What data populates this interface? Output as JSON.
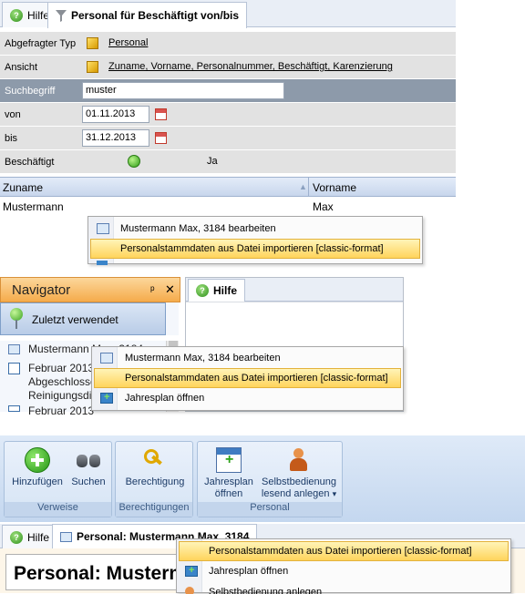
{
  "panel1": {
    "tabs": [
      {
        "label": "Hilfe",
        "icon": "help-icon"
      },
      {
        "label": "Personal für Beschäftigt von/bis",
        "icon": "filter-icon"
      }
    ],
    "filters": {
      "type_label": "Abgefragter Typ",
      "type_value": "Personal",
      "view_label": "Ansicht",
      "view_value": "Zuname, Vorname, Personalnummer, Beschäftigt, Karenzierung",
      "search_label": "Suchbegriff",
      "search_value": "muster",
      "from_label": "von",
      "from_value": "01.11.2013",
      "to_label": "bis",
      "to_value": "31.12.2013",
      "employed_label": "Beschäftigt",
      "employed_value": "Ja"
    },
    "grid": {
      "columns": [
        "Zuname",
        "Vorname"
      ],
      "rows": [
        [
          "Mustermann",
          "Max"
        ]
      ]
    },
    "context_menu": [
      "Mustermann Max, 3184 bearbeiten",
      "Personalstammdaten aus Datei importieren [classic-format]"
    ]
  },
  "panel2": {
    "navigator_title": "Navigator",
    "pin_glyph": "ᵖ",
    "close_glyph": "✕",
    "recent_label": "Zuletzt verwendet",
    "nav_items": [
      "Mustermann Max, 3184",
      "Februar 2013",
      "Abgeschlossen",
      "Reinigungsdienst",
      "Februar 2013"
    ],
    "hilfe_tab": "Hilfe",
    "context_menu": [
      "Mustermann Max, 3184 bearbeiten",
      "Personalstammdaten aus Datei importieren [classic-format]",
      "Jahresplan öffnen"
    ]
  },
  "panel3": {
    "groups": [
      {
        "label": "Verweise",
        "buttons": [
          "Hinzufügen",
          "Suchen"
        ]
      },
      {
        "label": "Berechtigungen",
        "buttons": [
          "Berechtigung"
        ]
      },
      {
        "label": "Personal",
        "buttons": [
          "Jahresplan öffnen",
          "Selbstbedienung lesend anlegen"
        ]
      }
    ],
    "btn_jahresplan_l1": "Jahresplan",
    "btn_jahresplan_l2": "öffnen",
    "btn_selbst_l1": "Selbstbedienung",
    "btn_selbst_l2": "lesend anlegen",
    "dropdown_glyph": "▾"
  },
  "panel4": {
    "tabs": [
      {
        "label": "Hilfe",
        "icon": "help-icon"
      },
      {
        "label": "Personal: Mustermann Max, 3184",
        "icon": "card-icon"
      }
    ],
    "page_title": "Personal: Mustermann Max, 3184",
    "context_menu": [
      "Personalstammdaten aus Datei importieren [classic-format]",
      "Jahresplan öffnen",
      "Selbstbedienung anlegen"
    ]
  },
  "colors": {
    "highlight": "#ffd45c",
    "navigator_header": "#f5ab4b",
    "filter_row": "#e2e2e2",
    "search_row": "#8d9aaa",
    "ribbon": "#c4d7ef"
  }
}
